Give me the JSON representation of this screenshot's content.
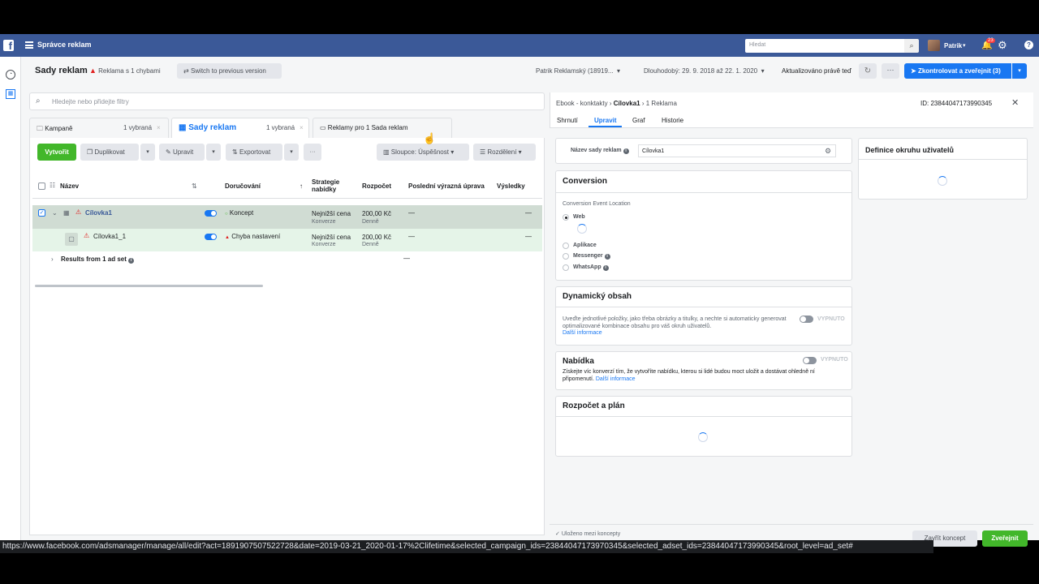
{
  "topbar": {
    "logo": "f",
    "app_title": "Správce reklam",
    "search_placeholder": "Hledat",
    "user_name": "Patrik",
    "notifications_count": "23"
  },
  "header": {
    "title": "Sady reklam",
    "warning": "Reklama s 1 chybami",
    "switch_version": "Switch to previous version",
    "account": "Patrik Reklamský (18919...",
    "date_range": "Dlouhodobý: 29. 9. 2018 až 22. 1. 2020",
    "updated": "Aktualizováno právě teď",
    "publish_button": "Zkontrolovat a zveřejnit (3)"
  },
  "filter": {
    "placeholder": "Hledejte nebo přidejte filtry"
  },
  "tabs": [
    {
      "label": "Kampaně",
      "pill": "1 vybraná"
    },
    {
      "label": "Sady reklam",
      "pill": "1 vybraná"
    },
    {
      "label": "Reklamy pro 1 Sada reklam"
    }
  ],
  "toolbar": {
    "create": "Vytvořit",
    "duplicate": "Duplikovat",
    "edit": "Upravit",
    "export": "Exportovat",
    "more": "···",
    "columns": "Sloupce: Úspěšnost",
    "breakdown": "Rozdělení"
  },
  "table": {
    "headers": {
      "name": "Název",
      "delivery": "Doručování",
      "strategy": "Strategie nabídky",
      "budget": "Rozpočet",
      "last_edit": "Poslední výrazná úprava",
      "results": "Výsledky"
    },
    "rows": [
      {
        "name": "Cílovka1",
        "delivery": "Koncept",
        "strategy": "Nejnižší cena",
        "strategy_sub": "Konverze",
        "budget": "200,00 Kč",
        "budget_sub": "Denně",
        "last_edit": "—",
        "results": "—"
      },
      {
        "name": "Cílovka1_1",
        "delivery": "Chyba nastavení",
        "strategy": "Nejnižší cena",
        "strategy_sub": "Konverze",
        "budget": "200,00 Kč",
        "budget_sub": "Denně",
        "last_edit": "—",
        "results": "—"
      }
    ],
    "summary": {
      "label": "Results from 1 ad set",
      "results": "—"
    }
  },
  "right_panel": {
    "breadcrumb": [
      "Ebook - konktakty",
      "Cílovka1",
      "1 Reklama"
    ],
    "id_label": "ID: 23844047173990345",
    "tabs": [
      "Shrnutí",
      "Upravit",
      "Graf",
      "Historie"
    ],
    "adset_name_label": "Název sady reklam",
    "adset_name_value": "Cílovka1",
    "audience_title": "Definice okruhu uživatelů",
    "conversion": {
      "title": "Conversion",
      "location_label": "Conversion Event Location",
      "options": [
        "Web",
        "Aplikace",
        "Messenger",
        "WhatsApp"
      ]
    },
    "dynamic": {
      "title": "Dynamický obsah",
      "text": "Uveďte jednotlivé položky, jako třeba obrázky a titulky, a nechte si automaticky generovat optimalizované kombinace obsahu pro váš okruh uživatelů.",
      "link": "Další informace",
      "switch": "VYPNUTO"
    },
    "offer": {
      "title": "Nabídka",
      "text": "Získejte víc konverzí tím, že vytvoříte nabídku, kterou si lidé budou moct uložit a dostávat ohledně ní připomenutí.",
      "link": "Další informace",
      "switch": "VYPNUTO"
    },
    "budget_title": "Rozpočet a plán",
    "saved": "Uloženo mezi koncepty",
    "close_draft": "Zavřít koncept",
    "publish": "Zveřejnit"
  },
  "status_url": "https://www.facebook.com/adsmanager/manage/all/edit?act=1891907507522728&date=2019-03-21_2020-01-17%2Clifetime&selected_campaign_ids=23844047173970345&selected_adset_ids=23844047173990345&root_level=ad_set#",
  "colors": {
    "brand": "#3b5998",
    "accent": "#1877f2",
    "success": "#42b72a",
    "error": "#e02020"
  }
}
